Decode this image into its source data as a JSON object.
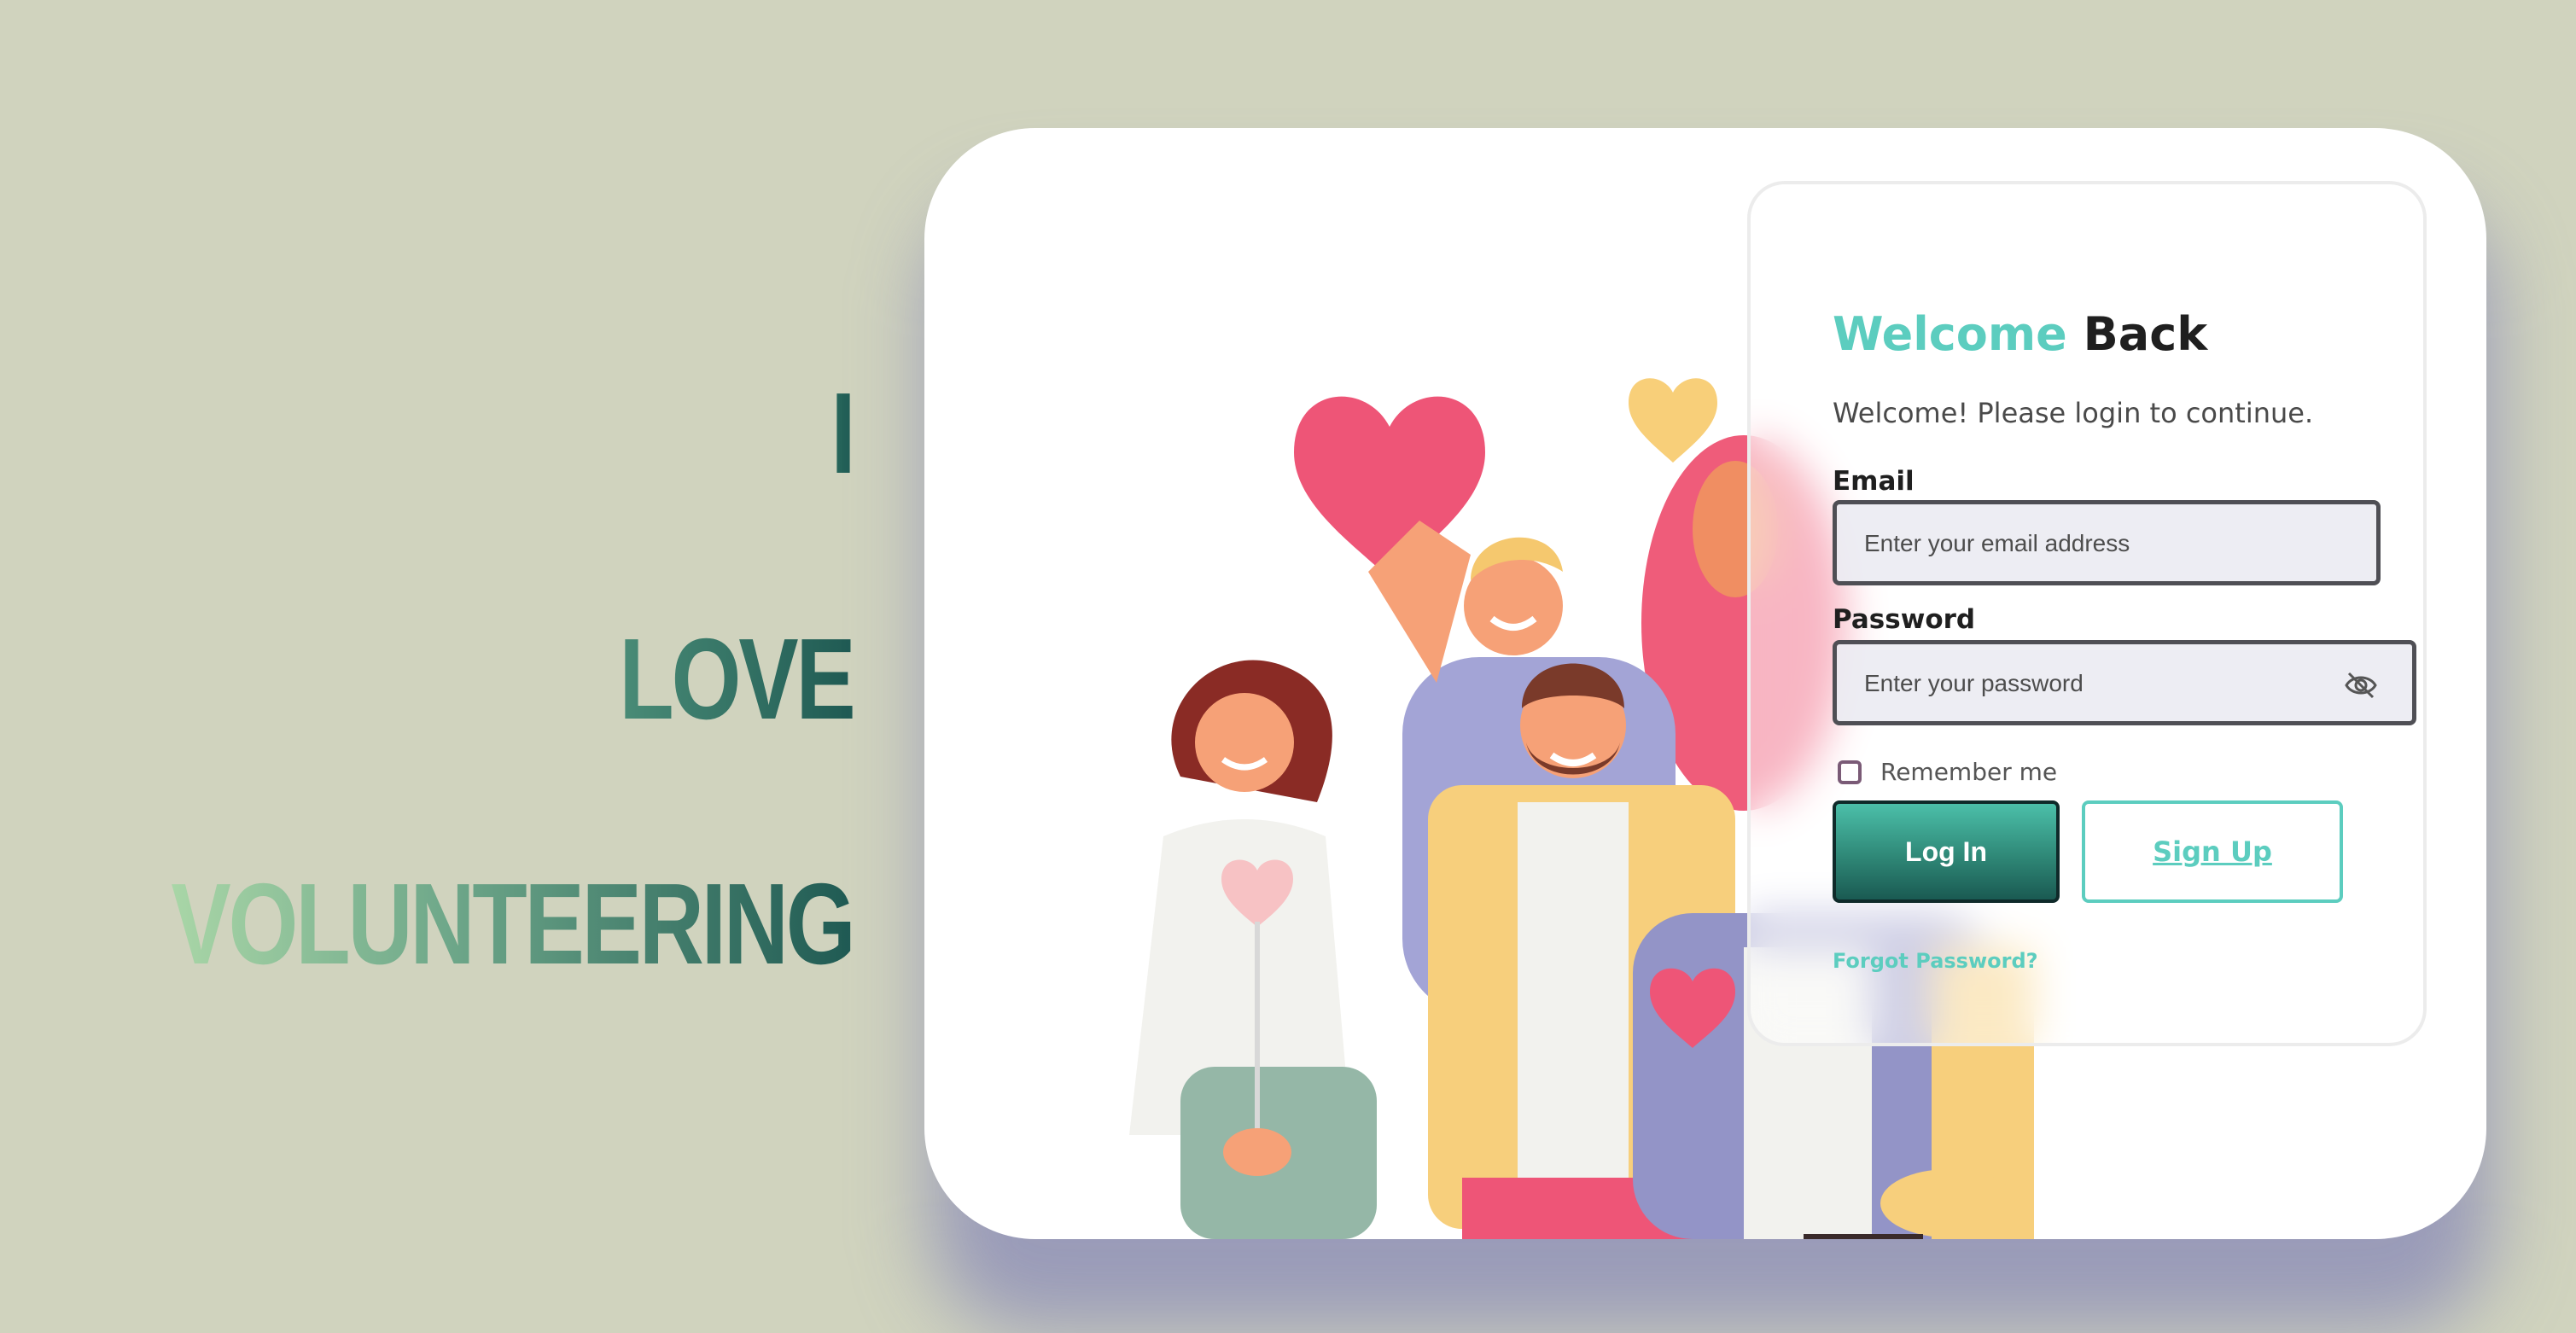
{
  "slogan": {
    "line1": "I",
    "line2": "LOVE",
    "line3": "VOLUNTEERING"
  },
  "login": {
    "title_accent": "Welcome",
    "title_rest": "Back",
    "subtitle": "Welcome! Please login to continue.",
    "email_label": "Email",
    "email_placeholder": "Enter your email address",
    "email_value": "",
    "password_label": "Password",
    "password_placeholder": "Enter your password",
    "password_value": "",
    "remember_label": "Remember me",
    "remember_checked": false,
    "login_button": "Log In",
    "signup_button": "Sign Up",
    "forgot_link": "Forgot Password?"
  },
  "icons": {
    "password_toggle": "eye-slash-icon"
  },
  "colors": {
    "background": "#d0d3be",
    "accent": "#5ccdbf",
    "button_dark": "#2f8877",
    "text_dark": "#1f1f1f"
  }
}
